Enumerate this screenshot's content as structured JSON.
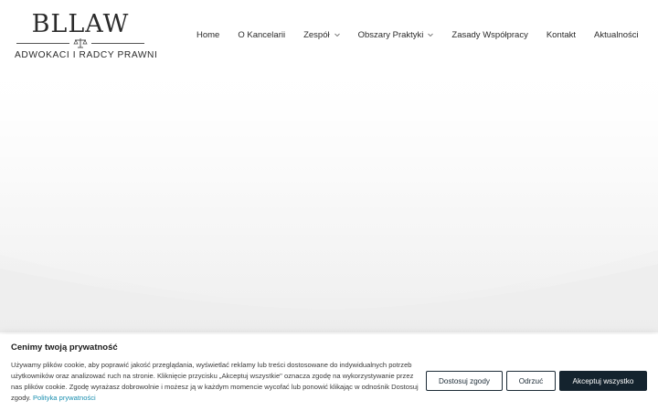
{
  "logo": {
    "word": "BLLAW",
    "tagline": "ADWOKACI I RADCY PRAWNI",
    "emblem_icon": "scales-of-justice-icon"
  },
  "nav": {
    "items": [
      {
        "label": "Home",
        "has_dropdown": false
      },
      {
        "label": "O Kancelarii",
        "has_dropdown": false
      },
      {
        "label": "Zespół",
        "has_dropdown": true
      },
      {
        "label": "Obszary Praktyki",
        "has_dropdown": true
      },
      {
        "label": "Zasady Współpracy",
        "has_dropdown": false
      },
      {
        "label": "Kontakt",
        "has_dropdown": false
      },
      {
        "label": "Aktualności",
        "has_dropdown": false
      }
    ]
  },
  "cookie": {
    "title": "Cenimy twoją prywatność",
    "text": "Używamy plików cookie, aby poprawić jakość przeglądania, wyświetlać reklamy lub treści dostosowane do indywidualnych potrzeb użytkowników oraz analizować ruch na stronie. Kliknięcie przycisku „Akceptuj wszystkie\" oznacza zgodę na wykorzystywanie przez nas plików cookie. Zgodę wyrażasz dobrowolnie i możesz ją w każdym momencie wycofać lub ponowić klikając w odnośnik Dostosuj zgody.",
    "link_label": "Polityka prywatności",
    "buttons": {
      "customize": "Dostosuj zgody",
      "reject": "Odrzuć",
      "accept_all": "Akceptuj wszystko"
    }
  },
  "colors": {
    "accent_dark": "#14232e",
    "link": "#1b8fb0",
    "hero_bg": "#efefef"
  }
}
